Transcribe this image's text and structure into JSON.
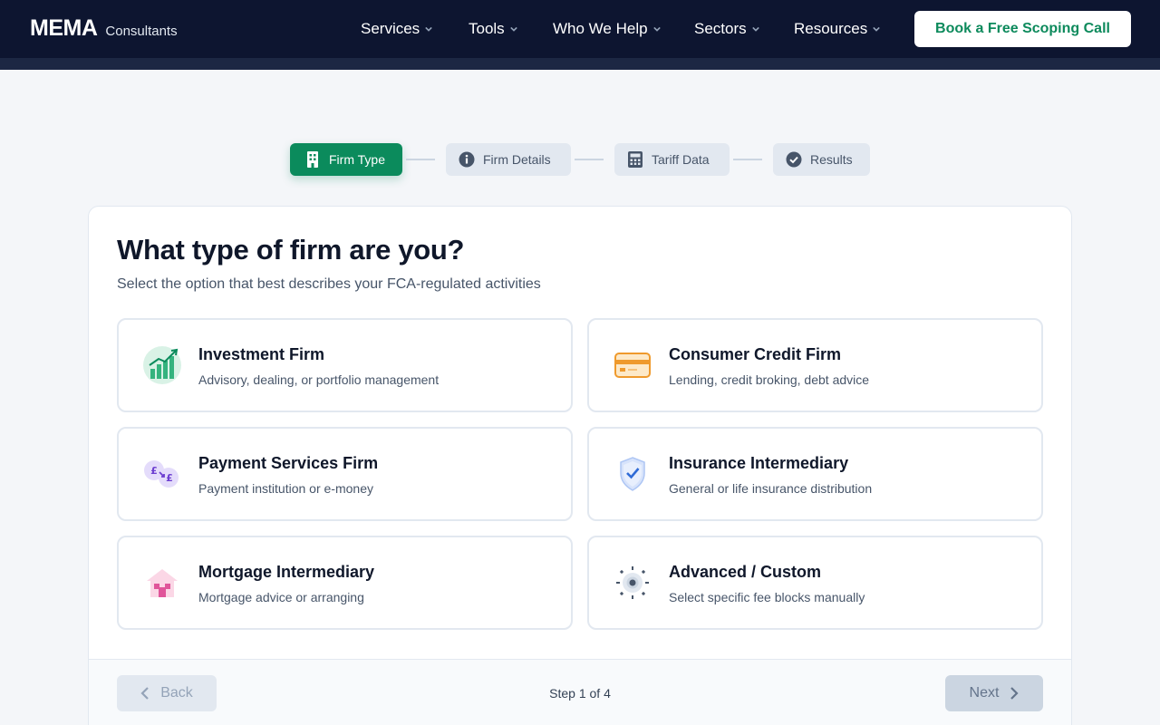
{
  "header": {
    "logo_main": "MEMA",
    "logo_sub": "Consultants",
    "nav": [
      {
        "label": "Services"
      },
      {
        "label": "Tools"
      },
      {
        "label": "Who We Help"
      },
      {
        "label": "Sectors"
      },
      {
        "label": "Resources"
      }
    ],
    "cta_label": "Book a Free Scoping Call"
  },
  "stepper": {
    "steps": [
      {
        "label": "Firm Type",
        "icon": "building-icon",
        "state": "active"
      },
      {
        "label": "Firm Details",
        "icon": "info-icon",
        "state": "inactive"
      },
      {
        "label": "Tariff Data",
        "icon": "calculator-icon",
        "state": "inactive"
      },
      {
        "label": "Results",
        "icon": "check-circle-icon",
        "state": "inactive"
      }
    ]
  },
  "main": {
    "title": "What type of firm are you?",
    "subtitle": "Select the option that best describes your FCA-regulated activities",
    "options": [
      {
        "name": "Investment Firm",
        "desc": "Advisory, dealing, or portfolio management",
        "icon": "chart-growth-icon"
      },
      {
        "name": "Consumer Credit Firm",
        "desc": "Lending, credit broking, debt advice",
        "icon": "credit-card-icon"
      },
      {
        "name": "Payment Services Firm",
        "desc": "Payment institution or e-money",
        "icon": "currency-exchange-icon"
      },
      {
        "name": "Insurance Intermediary",
        "desc": "General or life insurance distribution",
        "icon": "shield-check-icon"
      },
      {
        "name": "Mortgage Intermediary",
        "desc": "Mortgage advice or arranging",
        "icon": "house-icon"
      },
      {
        "name": "Advanced / Custom",
        "desc": "Select specific fee blocks manually",
        "icon": "gear-icon"
      }
    ]
  },
  "footer": {
    "back_label": "Back",
    "next_label": "Next",
    "step_text": "Step 1 of 4"
  },
  "colors": {
    "header_bg": "#0d1530",
    "accent_green": "#0b8b5c",
    "page_bg": "#f4f6f9"
  }
}
